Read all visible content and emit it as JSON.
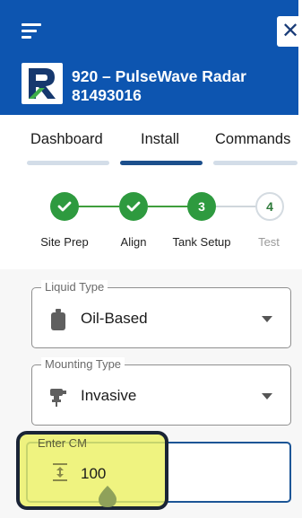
{
  "header": {
    "device_title": "920 – PulseWave Radar",
    "device_serial": "81493016",
    "close_symbol": "✕",
    "menu_icon": "hamburger-menu-icon",
    "logo_icon": "brand-r-logo",
    "background_color": "#0d55b0"
  },
  "tabs": [
    {
      "label": "Dashboard",
      "active": false
    },
    {
      "label": "Install",
      "active": true
    },
    {
      "label": "Commands",
      "active": false
    }
  ],
  "stepper": {
    "steps": [
      {
        "label": "Site Prep",
        "state": "done",
        "number": ""
      },
      {
        "label": "Align",
        "state": "done",
        "number": ""
      },
      {
        "label": "Tank Setup",
        "state": "current",
        "number": "3"
      },
      {
        "label": "Test",
        "state": "pending",
        "number": "4"
      }
    ],
    "done_color": "#2e9a3f"
  },
  "form": {
    "liquid_type": {
      "label": "Liquid Type",
      "value": "Oil-Based",
      "icon": "oil-canister-icon"
    },
    "mounting_type": {
      "label": "Mounting Type",
      "value": "Invasive",
      "icon": "sensor-mount-icon"
    },
    "enter_cm": {
      "label": "Enter CM",
      "value": "100",
      "icon": "height-adjust-icon"
    }
  },
  "highlight_color": "#ecf064"
}
